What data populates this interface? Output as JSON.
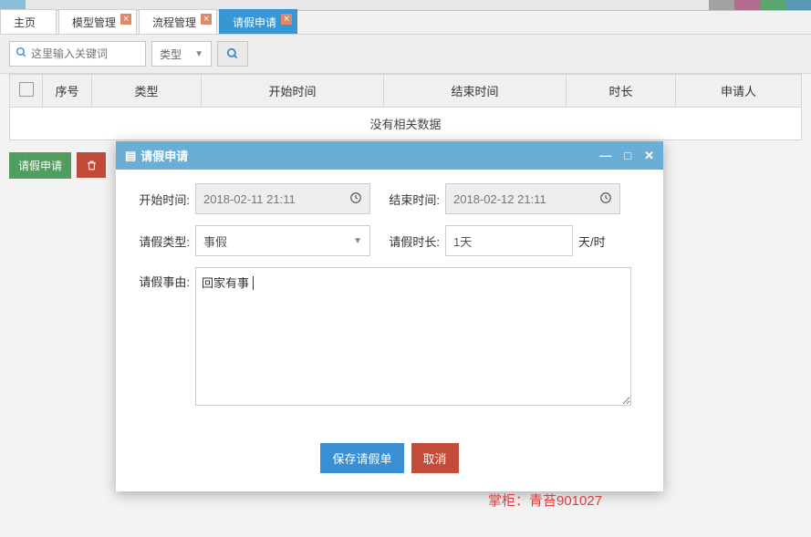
{
  "tabs": [
    {
      "label": "主页"
    },
    {
      "label": "模型管理"
    },
    {
      "label": "流程管理"
    },
    {
      "label": "请假申请"
    }
  ],
  "filter": {
    "search_placeholder": "这里输入关键词",
    "type_label": "类型"
  },
  "table": {
    "headers": {
      "index": "序号",
      "type": "类型",
      "start": "开始时间",
      "end": "结束时间",
      "duration": "时长",
      "applicant": "申请人"
    },
    "empty": "没有相关数据"
  },
  "actions": {
    "apply": "请假申请"
  },
  "dialog": {
    "title": "请假申请",
    "labels": {
      "start": "开始时间:",
      "end": "结束时间:",
      "type": "请假类型:",
      "duration": "请假时长:",
      "reason": "请假事由:"
    },
    "values": {
      "start": "2018-02-11 21:11",
      "end": "2018-02-12 21:11",
      "type": "事假",
      "duration": "1天",
      "reason": "回家有事"
    },
    "unit": "天/时",
    "buttons": {
      "save": "保存请假单",
      "cancel": "取消"
    }
  },
  "watermark": "掌柜：青苔901027"
}
